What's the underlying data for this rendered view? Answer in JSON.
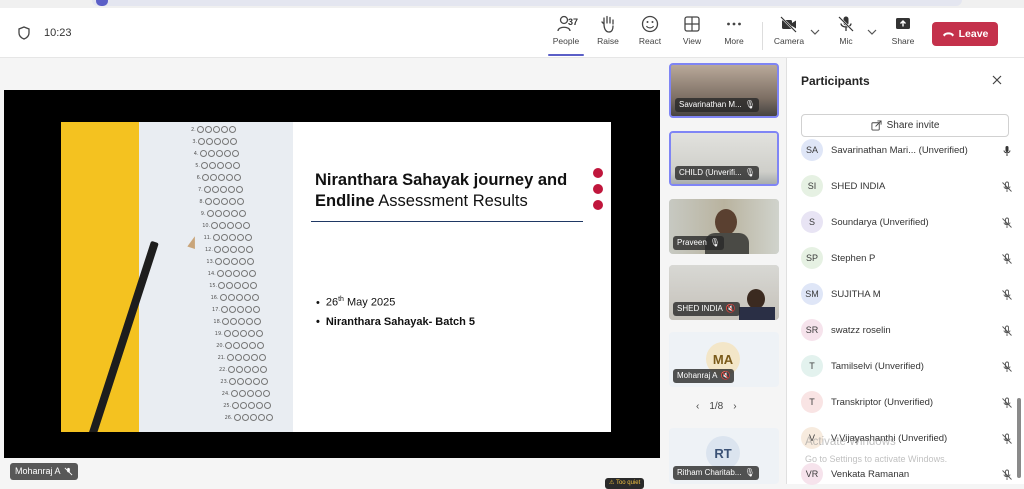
{
  "timer": "10:23",
  "toolbar": {
    "people_count": "37",
    "people": "People",
    "raise": "Raise",
    "react": "React",
    "view": "View",
    "more": "More",
    "camera": "Camera",
    "mic": "Mic",
    "share": "Share",
    "leave": "Leave"
  },
  "slide": {
    "title_bold": "Niranthara Sahayak journey and",
    "title_line2_bold": "Endline",
    "title_line2_rest": " Assessment Results",
    "bullet1_pre": "26",
    "bullet1_sup": "th",
    "bullet1_post": " May 2025",
    "bullet2": "Niranthara Sahayak- Batch 5"
  },
  "stage": {
    "too_quiet": "Too quiet",
    "presenter_name": "Mohanraj A"
  },
  "rail": {
    "tiles": [
      {
        "name": "Savarinathan M..."
      },
      {
        "name": "CHILD (Unverifi..."
      },
      {
        "name": "Praveen"
      },
      {
        "name": "SHED INDIA"
      },
      {
        "name": "Mohanraj A",
        "initials": "MA"
      },
      {
        "name": "Ritham Charitab...",
        "initials": "RT"
      }
    ],
    "pager": "1/8"
  },
  "panel": {
    "title": "Participants",
    "share_invite": "Share invite",
    "participants": [
      {
        "initials": "SA",
        "name": "Savarinathan Mari...  (Unverified)",
        "color": "#dfe6f7"
      },
      {
        "initials": "SI",
        "name": "SHED INDIA",
        "color": "#e6f1e3"
      },
      {
        "initials": "S",
        "name": "Soundarya (Unverified)",
        "color": "#e8e4f4"
      },
      {
        "initials": "SP",
        "name": "Stephen P",
        "color": "#e6f1e3"
      },
      {
        "initials": "SM",
        "name": "SUJITHA M",
        "color": "#dfe6f7"
      },
      {
        "initials": "SR",
        "name": "swatzz roselin",
        "color": "#f6e3ec"
      },
      {
        "initials": "T",
        "name": "Tamilselvi (Unverified)",
        "color": "#e3f2ee"
      },
      {
        "initials": "T",
        "name": "Transkriptor (Unverified)",
        "color": "#f9e4e4"
      },
      {
        "initials": "V",
        "name": "V.Vijayashanthi (Unverified)",
        "color": "#f7ebde"
      },
      {
        "initials": "VR",
        "name": "Venkata Ramanan",
        "color": "#f6e3ec"
      }
    ],
    "watermark_title": "Activate Windows",
    "watermark_sub": "Go to Settings to activate Windows."
  }
}
